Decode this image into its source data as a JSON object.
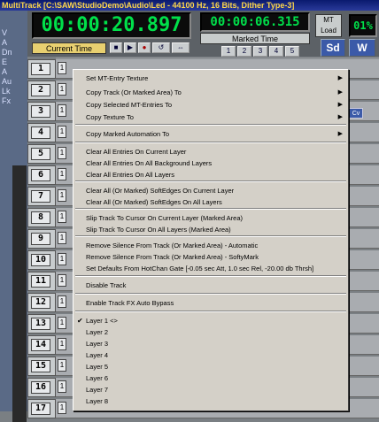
{
  "window": {
    "title": "MultiTrack   [C:\\SAW\\StudioDemo\\Audio\\Led  -  44100 Hz, 16 Bits, Dither Type-3]"
  },
  "transport": {
    "current_time_display": "00:00:20.897",
    "marked_time_display": "00:00:06.315",
    "current_time_label": "Current Time",
    "marked_time_label": "Marked Time",
    "percent_display": "01%",
    "mt_load_label": "MT Load",
    "buttons": [
      "Sd",
      "W"
    ],
    "small_buttons": [
      "1",
      "2",
      "3",
      "4",
      "5"
    ]
  },
  "left_toolbar": {
    "labels": [
      "V",
      "A",
      "Dn",
      "E",
      "A",
      "Au",
      "Lk",
      "Fx"
    ]
  },
  "tracks": [
    {
      "number": "1",
      "label": "1"
    },
    {
      "number": "2",
      "label": "1"
    },
    {
      "number": "3",
      "label": "1"
    },
    {
      "number": "4",
      "label": "1"
    },
    {
      "number": "5",
      "label": "1"
    },
    {
      "number": "6",
      "label": "1"
    },
    {
      "number": "7",
      "label": "1"
    },
    {
      "number": "8",
      "label": "1"
    },
    {
      "number": "9",
      "label": "1"
    },
    {
      "number": "10",
      "label": "1"
    },
    {
      "number": "11",
      "label": "1"
    },
    {
      "number": "12",
      "label": "1"
    },
    {
      "number": "13",
      "label": "1"
    },
    {
      "number": "14",
      "label": "1"
    },
    {
      "number": "15",
      "label": "1"
    },
    {
      "number": "16",
      "label": "1"
    },
    {
      "number": "17",
      "label": "1"
    }
  ],
  "clip_button": "Cv",
  "context_menu": {
    "items": [
      {
        "label": "Set MT-Entry Texture",
        "submenu": true
      },
      {
        "label": "Copy Track (Or Marked Area) To",
        "submenu": true
      },
      {
        "label": "Copy Selected MT-Entries To",
        "submenu": true
      },
      {
        "label": "Copy Texture To",
        "submenu": true
      },
      {
        "label": "Copy Marked Automation To",
        "submenu": true
      },
      {
        "label": "Clear All Entries On Current Layer"
      },
      {
        "label": "Clear All Entries On All Background Layers"
      },
      {
        "label": "Clear All Entries On All Layers"
      },
      {
        "label": "Clear All (Or Marked) SoftEdges On Current Layer"
      },
      {
        "label": "Clear All (Or Marked) SoftEdges On All Layers"
      },
      {
        "label": "Slip Track To Cursor On Current Layer (Marked Area)"
      },
      {
        "label": "Slip Track To Cursor On All Layers (Marked Area)"
      },
      {
        "label": "Remove Silence From Track (Or Marked Area) - Automatic"
      },
      {
        "label": "Remove Silence From Track (Or Marked Area) - SoftyMark"
      },
      {
        "label": "Set Defaults From HotChan Gate [-0.05 sec Att, 1.0 sec Rel, -20.00 db Thrsh]"
      },
      {
        "label": "Disable Track"
      },
      {
        "label": "Enable Track FX Auto Bypass"
      },
      {
        "label": "Layer 1 <>",
        "checked": true
      },
      {
        "label": "Layer 2"
      },
      {
        "label": "Layer 3"
      },
      {
        "label": "Layer 4"
      },
      {
        "label": "Layer 5"
      },
      {
        "label": "Layer 6"
      },
      {
        "label": "Layer 7"
      },
      {
        "label": "Layer 8"
      }
    ]
  }
}
